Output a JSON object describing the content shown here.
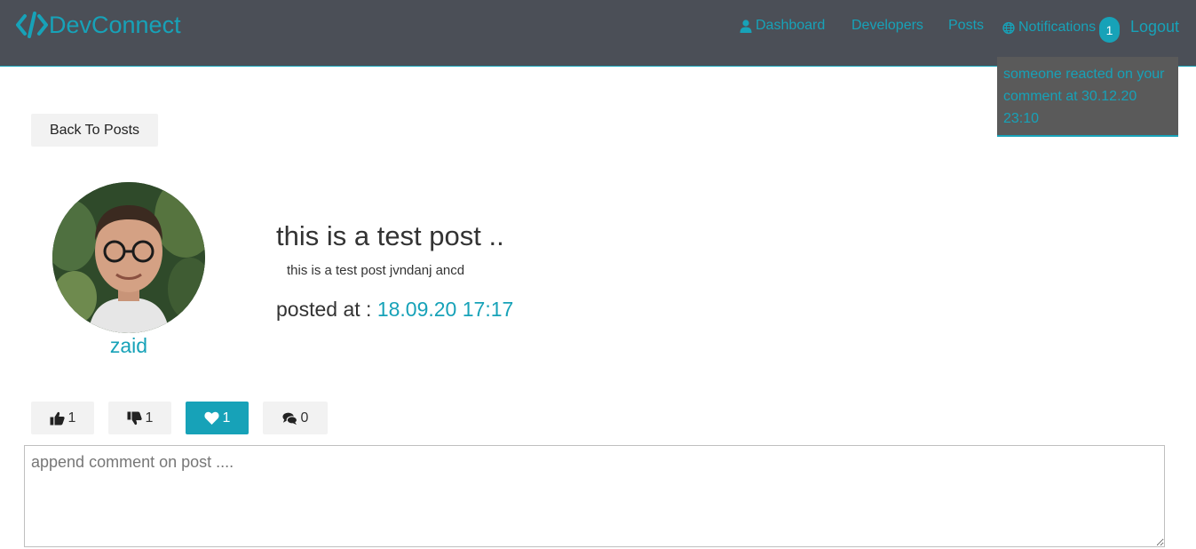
{
  "navbar": {
    "brand": "DevConnect",
    "brand_icon": "code-icon",
    "links": [
      {
        "label": "Dashboard",
        "icon": "user-icon"
      },
      {
        "label": "Developers"
      },
      {
        "label": "Posts"
      },
      {
        "label": "Notifications",
        "icon": "globe-icon"
      },
      {
        "label": "Logout"
      }
    ],
    "notification_count": "1",
    "accent_color": "#17a2b8",
    "background_color": "#4b4f57"
  },
  "notifications": {
    "items": [
      "someone reacted on your comment at 30.12.20 23:10"
    ]
  },
  "back_button": "Back To Posts",
  "post": {
    "author": "zaid",
    "title": "this is a test post ..",
    "body": "this is a test post jvndanj ancd",
    "posted_label": "posted at : ",
    "posted_at": "18.09.20 17:17"
  },
  "reactions": {
    "likes": "1",
    "dislikes": "1",
    "loves": "1",
    "comments": "0"
  },
  "comment_form": {
    "placeholder": "append comment on post ...."
  }
}
